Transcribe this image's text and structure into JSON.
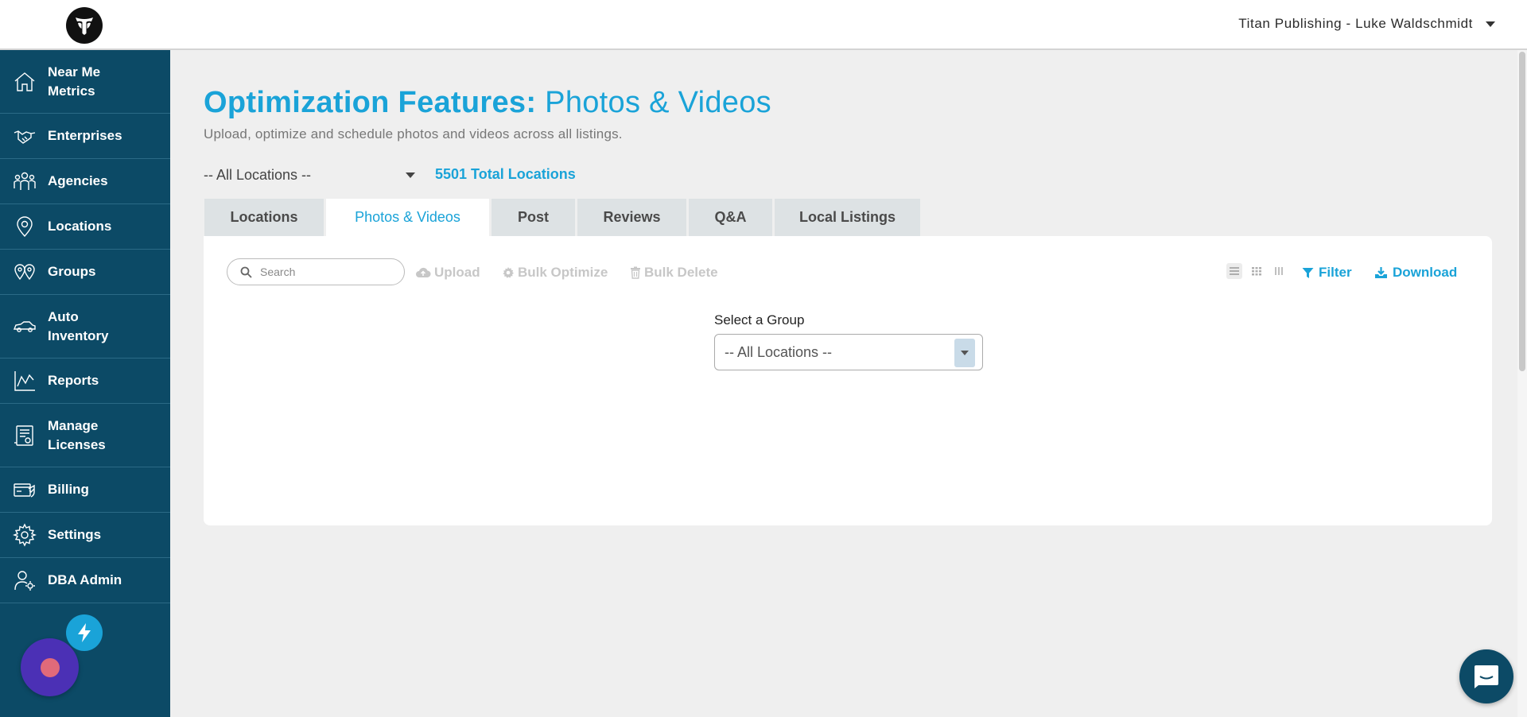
{
  "header": {
    "account_label": "Titan Publishing - Luke Waldschmidt"
  },
  "sidebar": {
    "items": [
      {
        "label": "Near Me Metrics",
        "icon": "home-icon"
      },
      {
        "label": "Enterprises",
        "icon": "handshake-icon"
      },
      {
        "label": "Agencies",
        "icon": "people-group-icon"
      },
      {
        "label": "Locations",
        "icon": "map-pin-icon"
      },
      {
        "label": "Groups",
        "icon": "multi-pin-icon"
      },
      {
        "label": "Auto Inventory",
        "icon": "car-icon"
      },
      {
        "label": "Reports",
        "icon": "line-chart-icon"
      },
      {
        "label": "Manage Licenses",
        "icon": "license-document-icon"
      },
      {
        "label": "Billing",
        "icon": "billing-card-icon"
      },
      {
        "label": "Settings",
        "icon": "gear-icon"
      },
      {
        "label": "DBA Admin",
        "icon": "user-gear-icon"
      }
    ]
  },
  "page": {
    "title_bold": "Optimization Features:",
    "title_light": "Photos & Videos",
    "subtitle": "Upload, optimize and schedule photos and videos across all listings.",
    "location_select_value": "-- All Locations --",
    "total_locations": "5501 Total Locations"
  },
  "tabs": [
    {
      "label": "Locations",
      "active": false
    },
    {
      "label": "Photos & Videos",
      "active": true
    },
    {
      "label": "Post",
      "active": false
    },
    {
      "label": "Reviews",
      "active": false
    },
    {
      "label": "Q&A",
      "active": false
    },
    {
      "label": "Local Listings",
      "active": false
    }
  ],
  "toolbar": {
    "search_placeholder": "Search",
    "upload_label": "Upload",
    "bulk_optimize_label": "Bulk Optimize",
    "bulk_delete_label": "Bulk Delete",
    "filter_label": "Filter",
    "download_label": "Download"
  },
  "group": {
    "label": "Select a Group",
    "value": "-- All Locations --"
  },
  "colors": {
    "accent": "#1aa3d8",
    "sidebar_bg": "#0c4a66",
    "disabled_text": "#c7c7c7"
  }
}
